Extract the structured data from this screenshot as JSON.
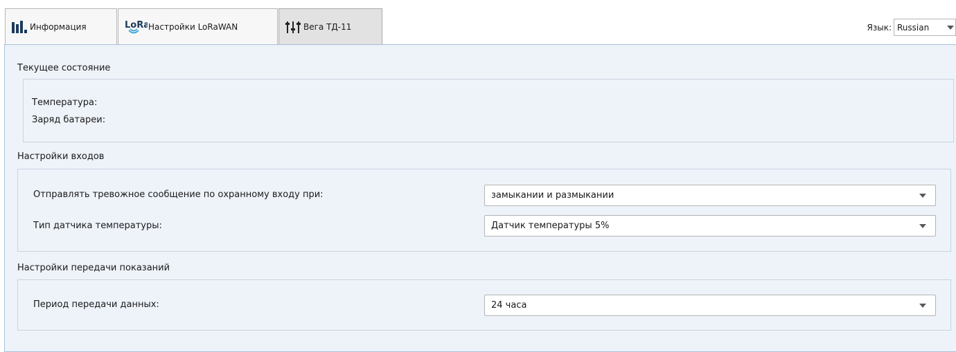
{
  "tabs": [
    {
      "label": "Информация",
      "icon": "bar-chart-icon"
    },
    {
      "label": "Настройки LoRaWAN",
      "icon": "lora-icon",
      "icon_text": "LoRa"
    },
    {
      "label": "Вега ТД-11",
      "icon": "sliders-icon"
    }
  ],
  "active_tab": 2,
  "language": {
    "label": "Язык:",
    "value": "Russian"
  },
  "current_state": {
    "title": "Текущее состояние",
    "temperature_label": "Температура:",
    "battery_label": "Заряд батареи:"
  },
  "inputs": {
    "title": "Настройки входов",
    "alarm_label": "Отправлять тревожное сообщение по охранному входу при:",
    "alarm_value": "замыкании и размыкании",
    "sensor_label": "Тип датчика температуры:",
    "sensor_value": "Датчик температуры 5%"
  },
  "transmission": {
    "title": "Настройки передачи показаний",
    "period_label": "Период передачи данных:",
    "period_value": "24 часа"
  },
  "colors": {
    "accent_blue": "#2a7fd4",
    "panel_bg": "#eef3fa"
  }
}
